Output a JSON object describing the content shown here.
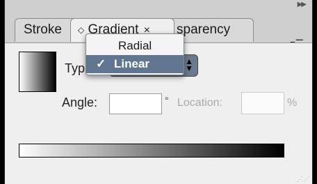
{
  "tabs": [
    {
      "label": "Stroke"
    },
    {
      "label": "Gradient",
      "active": true
    },
    {
      "label": "Transparency"
    }
  ],
  "tabs_visible": {
    "stroke": "Stroke",
    "gradient_arrows": "◇",
    "gradient_close": "×",
    "transparency": "sparency"
  },
  "gradient_panel": {
    "type_label": "Typ",
    "type_value": "Linear",
    "angle_label": "Angle:",
    "angle_value": "",
    "degree_symbol": "°",
    "location_label": "Location:",
    "location_value": "",
    "percent_symbol": "%"
  },
  "type_menu": {
    "options": [
      {
        "label": "Radial",
        "selected": false
      },
      {
        "label": "Linear",
        "selected": true
      }
    ],
    "check_mark": "✓"
  },
  "icons": {
    "collapse": "double-right-arrow-icon",
    "panel_menu": "panel-menu-icon",
    "resize": "resize-grip-icon"
  },
  "colors": {
    "menu_highlight": "#5f7590",
    "select_bg": "#6a7a8e",
    "panel_bg": "#efefef"
  }
}
